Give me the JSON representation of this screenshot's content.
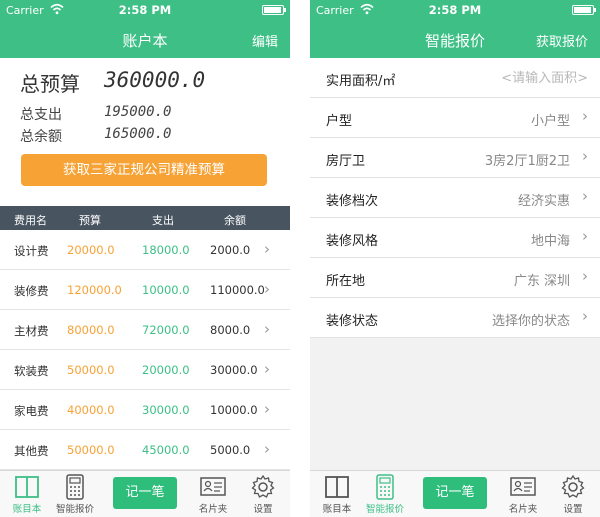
{
  "status": {
    "carrier": "Carrier",
    "time": "2:58 PM"
  },
  "left": {
    "title": "账户本",
    "edit": "编辑",
    "summary": {
      "total_budget_label": "总预算",
      "total_budget_value": "360000.0",
      "total_spent_label": "总支出",
      "total_spent_value": "195000.0",
      "total_left_label": "总余额",
      "total_left_value": "165000.0"
    },
    "cta": "获取三家正规公司精准预算",
    "table_headers": [
      "费用名",
      "预算",
      "支出",
      "余额"
    ],
    "rows": [
      {
        "name": "设计费",
        "budget": "20000.0",
        "spent": "18000.0",
        "left": "2000.0"
      },
      {
        "name": "装修费",
        "budget": "120000.0",
        "spent": "10000.0",
        "left": "110000.0"
      },
      {
        "name": "主材费",
        "budget": "80000.0",
        "spent": "72000.0",
        "left": "8000.0"
      },
      {
        "name": "软装费",
        "budget": "50000.0",
        "spent": "20000.0",
        "left": "30000.0"
      },
      {
        "name": "家电费",
        "budget": "40000.0",
        "spent": "30000.0",
        "left": "10000.0"
      },
      {
        "name": "其他费",
        "budget": "50000.0",
        "spent": "45000.0",
        "left": "5000.0"
      }
    ]
  },
  "right": {
    "title": "智能报价",
    "get_quote": "获取报价",
    "fields": [
      {
        "label": "实用面积/㎡",
        "value": "",
        "placeholder": "<请输入面积>"
      },
      {
        "label": "户型",
        "value": "小户型"
      },
      {
        "label": "房厅卫",
        "value": "3房2厅1厨2卫"
      },
      {
        "label": "装修档次",
        "value": "经济实惠"
      },
      {
        "label": "装修风格",
        "value": "地中海"
      },
      {
        "label": "所在地",
        "value": "广东 深圳"
      },
      {
        "label": "装修状态",
        "value": "选择你的状态"
      }
    ]
  },
  "tabbar": {
    "items": [
      "账目本",
      "智能报价",
      "记一笔",
      "名片夹",
      "设置"
    ]
  },
  "icons": {
    "wifi": "wifi-icon",
    "battery": "battery-icon",
    "chevron": "chevron-right-icon",
    "book": "book-icon",
    "calculator": "calculator-icon",
    "card": "business-card-icon",
    "gear": "gear-icon"
  },
  "colors": {
    "brand_green": "#3dbf86",
    "accent_orange": "#f7a235",
    "header_dark": "#485460"
  }
}
